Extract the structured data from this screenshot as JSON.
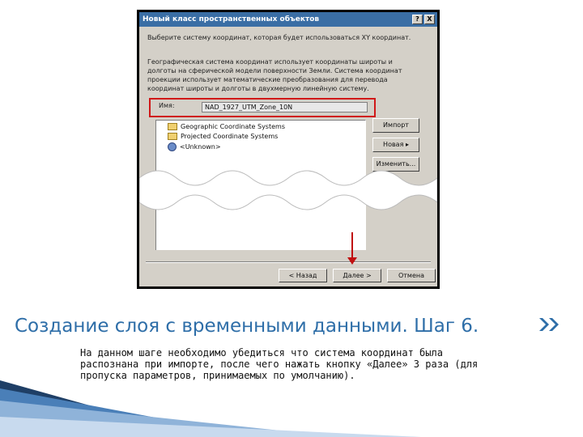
{
  "dialog": {
    "title": "Новый класс пространственных объектов",
    "help_btn": "?",
    "close_btn": "X",
    "intro_text": "Выберите систему координат, которая будет использоваться XY координат.",
    "description": "Географическая система координат использует координаты широты и долготы на сферической модели поверхности Земли. Система координат проекции использует математические преобразования для перевода координат широты и долготы в двухмерную линейную систему.",
    "name_label": "Имя:",
    "name_value": "NAD_1927_UTM_Zone_10N",
    "tree_items": [
      "Geographic Coordinate Systems",
      "Projected Coordinate Systems",
      "<Unknown>"
    ],
    "side_buttons": [
      "Импорт",
      "Новая",
      "Изменить..."
    ],
    "bottom_buttons": {
      "back": "< Назад",
      "next": "Далее >",
      "cancel": "Отмена"
    }
  },
  "slide": {
    "title": "Создание слоя с временными данными. Шаг 6.",
    "body": "На данном шаге необходимо убедиться что система координат была распознана при импорте, после чего нажать кнопку «Далее» 3 раза (для пропуска параметров, принимаемых по умолчанию)."
  },
  "colors": {
    "title_blue": "#2e6ea8",
    "highlight_red": "#d01818",
    "dialog_bg": "#d4d0c8"
  }
}
